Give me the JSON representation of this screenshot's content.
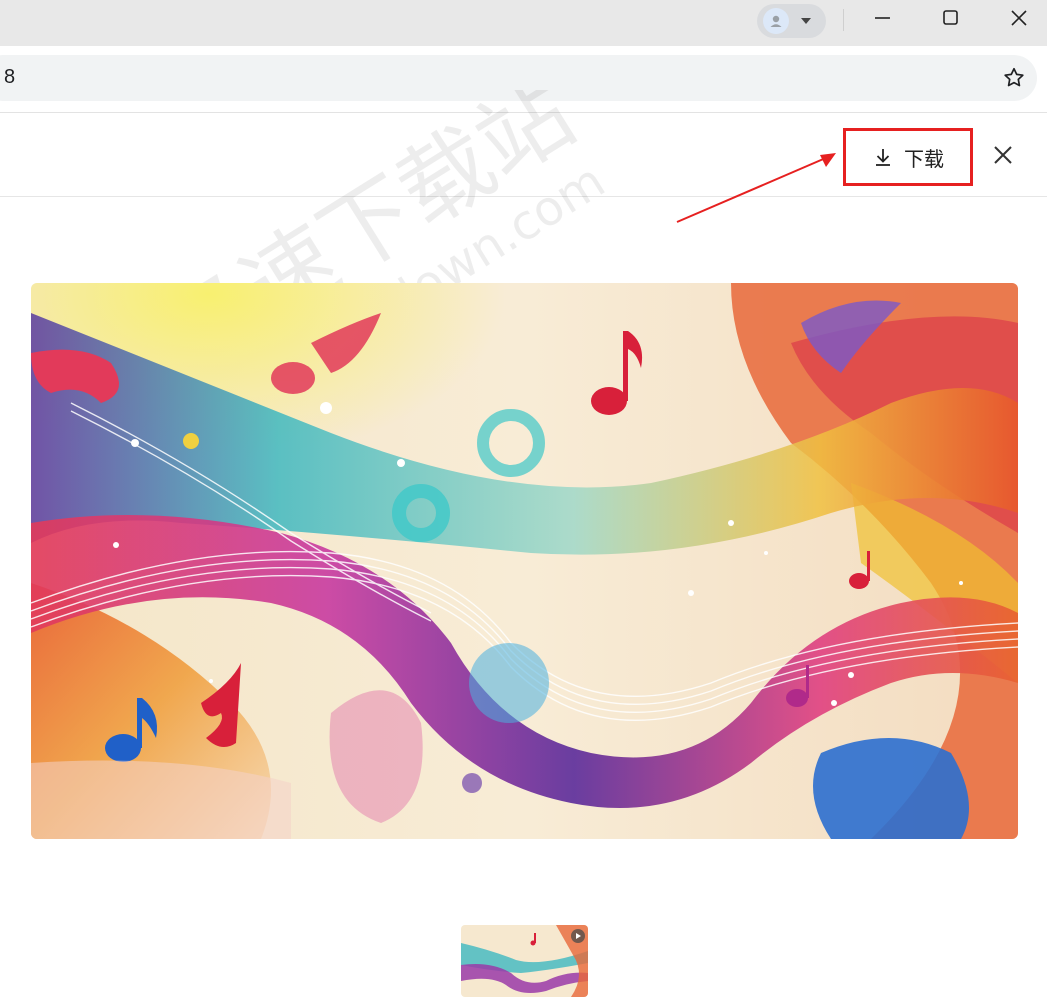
{
  "browser": {
    "url_fragment": "8",
    "window_controls": {
      "minimize_icon": "minimize-icon",
      "maximize_icon": "maximize-icon",
      "close_icon": "close-icon"
    },
    "profile_icon": "profile-avatar-icon",
    "bookmark_icon": "star-icon"
  },
  "viewer": {
    "download_label": "下载",
    "download_icon": "download-icon",
    "close_icon": "close-icon",
    "main_image_description_colors": [
      "#f6e8cf",
      "#e23a5a",
      "#3fb8c0",
      "#6c3aa4",
      "#f0b030",
      "#e85a2a",
      "#2c6fcf"
    ],
    "thumbnail_play_icon": "play-icon"
  },
  "annotation": {
    "highlight_color": "#e62020"
  },
  "watermark": {
    "text_cn": "极速下载站",
    "text_en": "mydown.com"
  }
}
